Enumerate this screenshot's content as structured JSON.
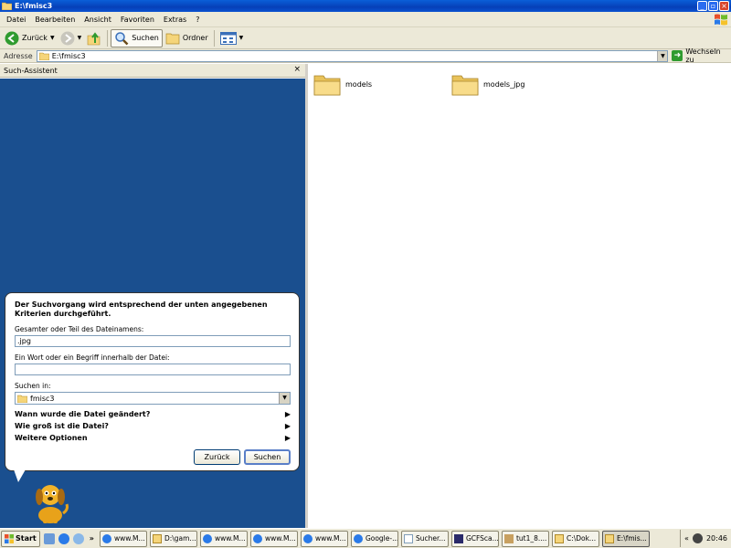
{
  "window": {
    "title": "E:\\fmisc3"
  },
  "menu": [
    "Datei",
    "Bearbeiten",
    "Ansicht",
    "Favoriten",
    "Extras",
    "?"
  ],
  "toolbar": {
    "back": "Zurück",
    "search": "Suchen",
    "folders": "Ordner"
  },
  "address": {
    "label": "Adresse",
    "value": "E:\\fmisc3",
    "go": "Wechseln zu"
  },
  "search_pane": {
    "title": "Such-Assistent",
    "close": "×",
    "heading": "Der Suchvorgang wird entsprechend der unten angegebenen Kriterien durchgeführt.",
    "filename_label": "Gesamter oder Teil des Dateinamens:",
    "filename_value": ".jpg",
    "text_label": "Ein Wort oder ein Begriff innerhalb der Datei:",
    "text_value": "",
    "lookin_label": "Suchen in:",
    "lookin_value": "fmisc3",
    "options": [
      "Wann wurde die Datei geändert?",
      "Wie groß ist die Datei?",
      "Weitere Optionen"
    ],
    "back_button": "Zurück",
    "search_button": "Suchen"
  },
  "files": [
    {
      "name": "models"
    },
    {
      "name": "models_jpg"
    }
  ],
  "taskbar": {
    "start": "Start",
    "chevron": "»",
    "tasks": [
      {
        "label": "www.M...",
        "icon": "ie-icon"
      },
      {
        "label": "D:\\gam...",
        "icon": "folder-icon"
      },
      {
        "label": "www.M...",
        "icon": "ie-icon"
      },
      {
        "label": "www.M...",
        "icon": "ie-icon"
      },
      {
        "label": "www.M...",
        "icon": "ie-icon"
      },
      {
        "label": "Google-...",
        "icon": "ie-icon"
      },
      {
        "label": "Sucher...",
        "icon": "document-icon"
      },
      {
        "label": "GCFSca...",
        "icon": "app-icon"
      },
      {
        "label": "tut1_8....",
        "icon": "archive-icon"
      },
      {
        "label": "C:\\Dok...",
        "icon": "folder-icon"
      },
      {
        "label": "E:\\fmis...",
        "icon": "folder-icon"
      }
    ],
    "tray_chevron": "«",
    "clock": "20:46"
  },
  "colors": {
    "search_pane_bg": "#1a4f8f",
    "titlebar": "#0640b8",
    "folder": "#f5d57a"
  }
}
